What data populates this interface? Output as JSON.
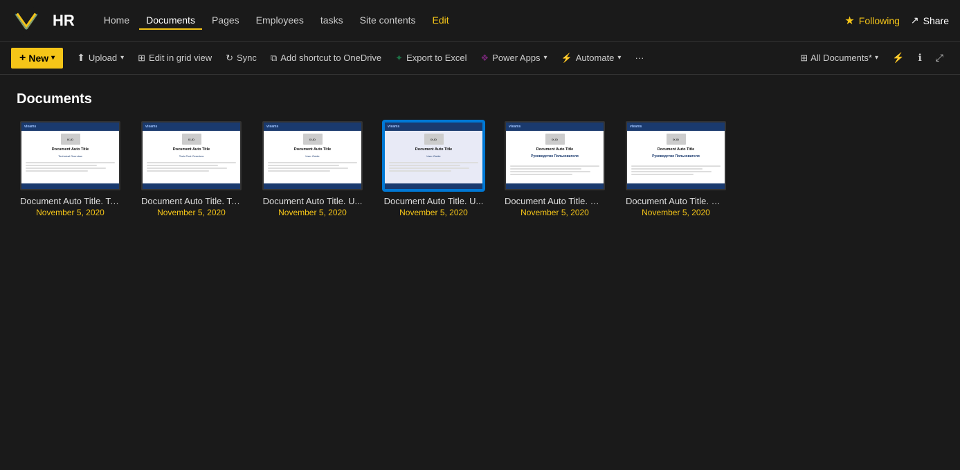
{
  "site": {
    "title": "HR",
    "logo_letter": "V"
  },
  "nav": {
    "items": [
      {
        "label": "Home",
        "active": false
      },
      {
        "label": "Documents",
        "active": true
      },
      {
        "label": "Pages",
        "active": false
      },
      {
        "label": "Employees",
        "active": false
      },
      {
        "label": "tasks",
        "active": false
      },
      {
        "label": "Site contents",
        "active": false
      },
      {
        "label": "Edit",
        "active": false,
        "special": "edit"
      }
    ]
  },
  "top_actions": {
    "following_label": "Following",
    "share_label": "Share"
  },
  "toolbar": {
    "new_label": "New",
    "upload_label": "Upload",
    "edit_grid_label": "Edit in grid view",
    "sync_label": "Sync",
    "shortcut_label": "Add shortcut to OneDrive",
    "export_label": "Export to Excel",
    "power_apps_label": "Power Apps",
    "automate_label": "Automate",
    "more_label": "···",
    "all_docs_label": "All Documents*"
  },
  "section": {
    "title": "Documents"
  },
  "documents": [
    {
      "name": "Document Auto Title. Te...",
      "date": "November 5, 2020",
      "type": "tech",
      "subtitle": "Technical Overview",
      "selected": false
    },
    {
      "name": "Document Auto Title. Te...",
      "date": "November 5, 2020",
      "type": "tech",
      "subtitle": "Tech-Post Overview",
      "selected": false
    },
    {
      "name": "Document Auto Title. U...",
      "date": "November 5, 2020",
      "type": "user",
      "subtitle": "User Guide",
      "selected": false
    },
    {
      "name": "Document Auto Title. U...",
      "date": "November 5, 2020",
      "type": "user",
      "subtitle": "User Guide",
      "selected": true
    },
    {
      "name": "Document Auto Title. Ру...",
      "date": "November 5, 2020",
      "type": "ru",
      "subtitle": "Руководство Пользователя",
      "selected": false
    },
    {
      "name": "Document Auto Title. Ру...",
      "date": "November 5, 2020",
      "type": "ru",
      "subtitle": "Руководство Пользователя",
      "selected": false
    }
  ]
}
